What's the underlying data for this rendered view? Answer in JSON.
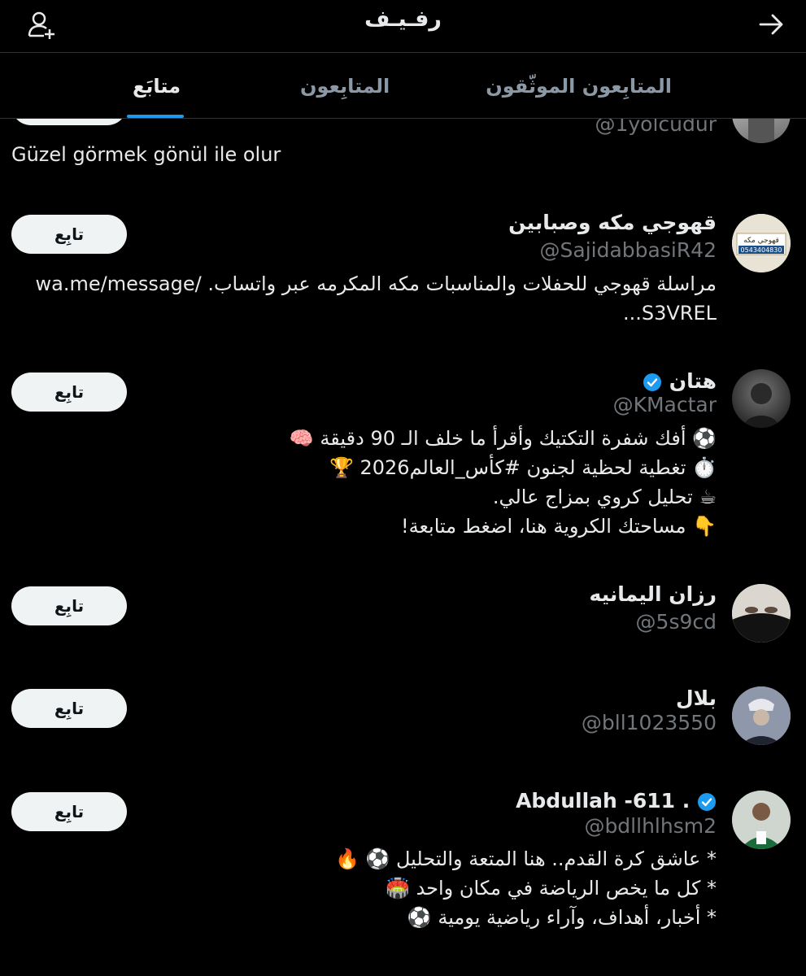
{
  "header": {
    "title": "رفـيـف",
    "add_user_icon": "add-user-icon",
    "forward_icon": "arrow-right-icon"
  },
  "tabs": [
    {
      "label": "المتابِعون الموثّقون"
    },
    {
      "label": "المتابِعون"
    },
    {
      "label": "متابَع"
    }
  ],
  "partial": {
    "handle": "@1yolcudur",
    "bio": "Güzel görmek gönül ile olur"
  },
  "users": [
    {
      "name": "قهوجي مكه وصبابين",
      "handle": "@SajidabbasiR42",
      "follow_label": "تابِع",
      "bio_lines": [
        "مراسلة قهوجي للحفلات والمناسبات مكه المكرمه عبر واتساب. /wa.me/message",
        "S3VREL..."
      ]
    },
    {
      "name": "هتان",
      "verified": true,
      "handle": "@KMactar",
      "follow_label": "تابِع",
      "bio_lines": [
        "⚽ أفك شفرة التكتيك وأقرأ ما خلف الـ 90 دقيقة 🧠",
        "⏱️ تغطية لحظية لجنون #كأس_العالم2026 🏆",
        "☕ تحليل كروي بمزاج عالي.",
        "👇 مساحتك الكروية هنا، اضغط متابعة!"
      ]
    },
    {
      "name": "رزان اليمانيه",
      "handle": "@5s9cd",
      "follow_label": "تابِع"
    },
    {
      "name": "بلال",
      "handle": "@bll1023550",
      "follow_label": "تابِع"
    },
    {
      "name": "Abdullah -611 .",
      "verified": true,
      "handle": "@bdllhlhsm2",
      "follow_label": "تابِع",
      "bio_lines": [
        "* عاشق كرة القدم.. هنا المتعة والتحليل ⚽ 🔥",
        "* كل ما يخص الرياضة في مكان واحد 🏟️",
        "* أخبار، أهداف، وآراء رياضية يومية ⚽"
      ]
    }
  ],
  "avatar_text": {
    "line1": "قهوجي مكه",
    "line2": "0543404830"
  }
}
